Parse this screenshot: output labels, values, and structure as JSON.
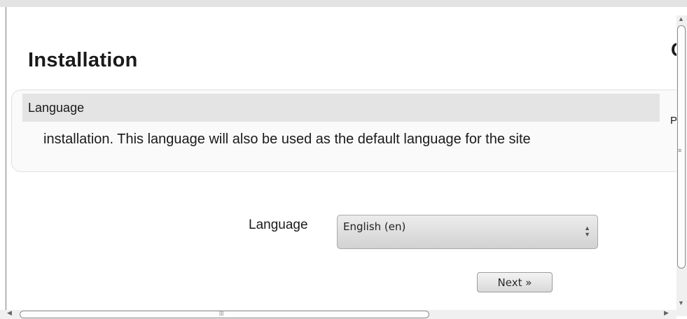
{
  "page": {
    "title": "Installation",
    "clipped_char": "C",
    "clipped_char_2": "P"
  },
  "section": {
    "header": "Language",
    "description": "installation. This language will also be used as the default language for the site"
  },
  "form": {
    "language_label": "Language",
    "language_selected": "English (en)",
    "next_label": "Next »"
  },
  "icons": {
    "select_arrows": "up-down-arrows-icon",
    "scroll_up": "triangle-up-icon",
    "scroll_down": "triangle-down-icon",
    "scroll_left": "triangle-left-icon",
    "scroll_right": "triangle-right-icon"
  }
}
